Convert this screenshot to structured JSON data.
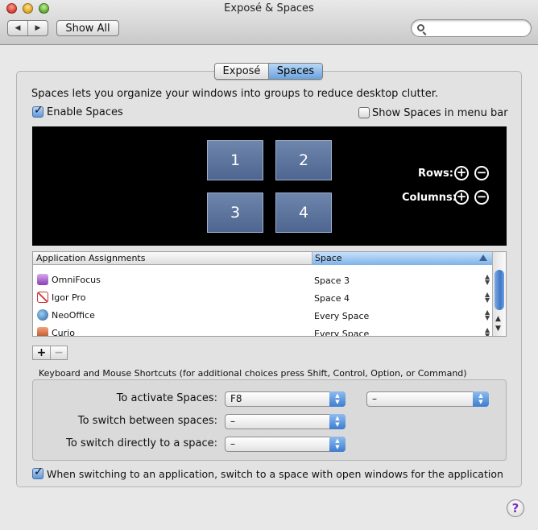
{
  "window": {
    "title": "Exposé & Spaces"
  },
  "toolbar": {
    "back": "◀",
    "forward": "▶",
    "show_all": "Show All",
    "search_placeholder": ""
  },
  "tabs": [
    {
      "label": "Exposé",
      "selected": false
    },
    {
      "label": "Spaces",
      "selected": true
    }
  ],
  "description": "Spaces lets you organize your windows into groups to reduce desktop clutter.",
  "enable_spaces": {
    "label": "Enable Spaces",
    "checked": true
  },
  "show_in_menubar": {
    "label": "Show Spaces in menu bar",
    "checked": false
  },
  "spaces": [
    "1",
    "2",
    "3",
    "4"
  ],
  "rows_label": "Rows:",
  "columns_label": "Columns:",
  "add_symbol": "+",
  "remove_symbol": "−",
  "app_table": {
    "headers": {
      "app": "Application Assignments",
      "space": "Space"
    },
    "rows": [
      {
        "app": "OmniFocus",
        "space": "Space 3",
        "icon": "omnifocus-icon"
      },
      {
        "app": "Igor Pro",
        "space": "Space 4",
        "icon": "igor-pro-icon"
      },
      {
        "app": "NeoOffice",
        "space": "Every Space",
        "icon": "neooffice-icon"
      },
      {
        "app": "Curio",
        "space": "Every Space",
        "icon": "curio-icon"
      }
    ]
  },
  "list_buttons": {
    "add": "+",
    "remove": "−"
  },
  "shortcuts": {
    "title": "Keyboard and Mouse Shortcuts (for additional choices press Shift, Control, Option, or Command)",
    "activate_label": "To activate Spaces:",
    "activate_value": "F8",
    "activate_mouse_value": "–",
    "switch_between_label": "To switch between spaces:",
    "switch_between_value": "–",
    "switch_directly_label": "To switch directly to a space:",
    "switch_directly_value": "–"
  },
  "switch_on_activate": {
    "label": "When switching to an application, switch to a space with open windows for the application",
    "checked": true
  },
  "help": "?"
}
